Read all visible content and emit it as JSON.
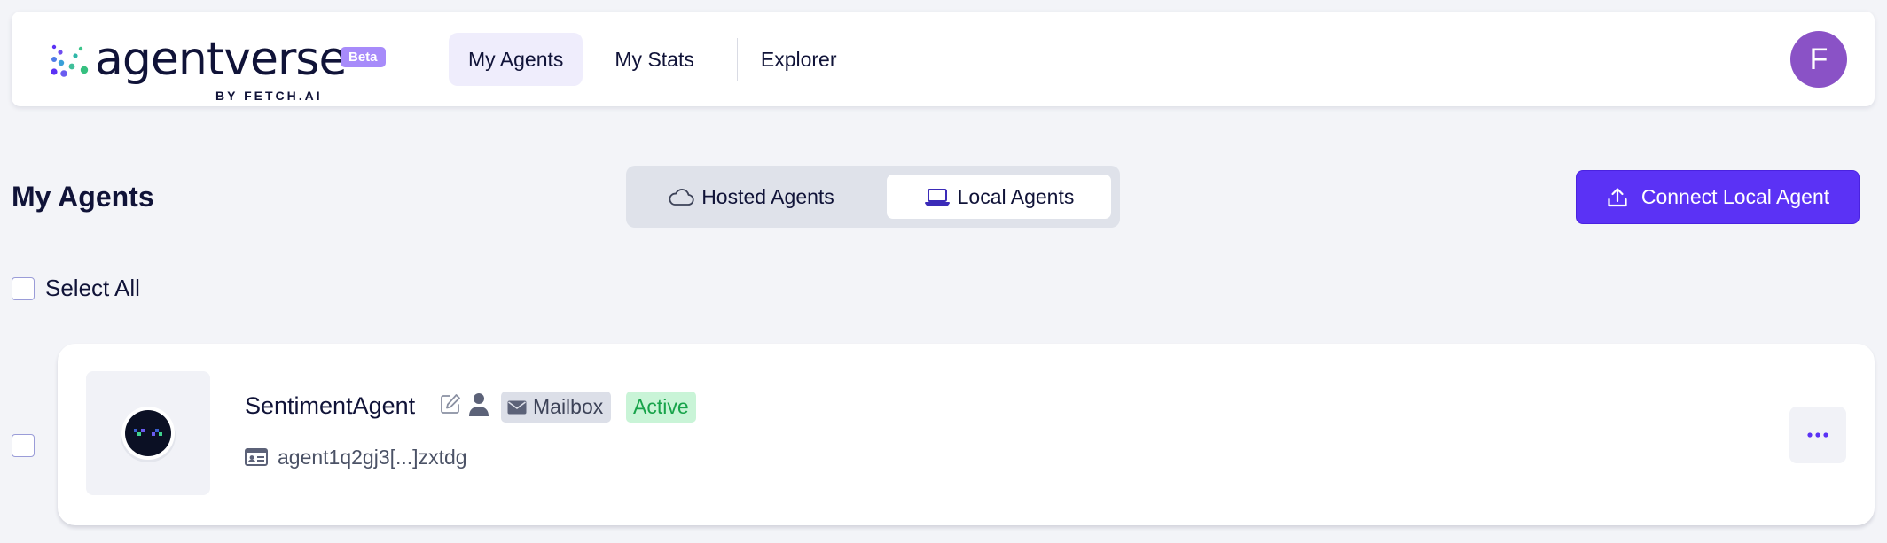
{
  "header": {
    "logo": {
      "word": "agentverse",
      "beta": "Beta",
      "by": "BY FETCH.AI"
    },
    "nav": [
      {
        "label": "My Agents",
        "active": true
      },
      {
        "label": "My Stats",
        "active": false
      },
      {
        "label": "Explorer",
        "active": false
      }
    ],
    "avatar_initial": "F"
  },
  "page": {
    "title": "My Agents",
    "tabs": [
      {
        "label": "Hosted Agents",
        "icon": "cloud-icon",
        "selected": false
      },
      {
        "label": "Local Agents",
        "icon": "laptop-icon",
        "selected": true
      }
    ],
    "connect_button": "Connect Local Agent",
    "select_all": "Select All"
  },
  "agents": [
    {
      "name": "SentimentAgent",
      "badge_mailbox": "Mailbox",
      "badge_status": "Active",
      "address": "agent1q2gj3[...]zxtdg"
    }
  ],
  "colors": {
    "accent": "#5b32f5",
    "beta_badge": "#a78bfa",
    "avatar": "#8a52c6",
    "status_active_bg": "#c9f4d7",
    "status_active_text": "#17a34a"
  }
}
